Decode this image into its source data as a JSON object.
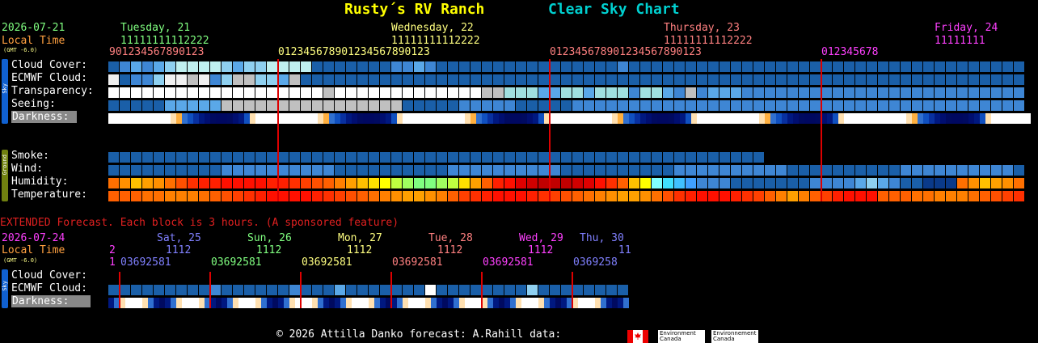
{
  "header": {
    "site_name": "Rusty´s RV Ranch",
    "chart_name": "Clear Sky Chart",
    "site_color": "#ffff00",
    "chart_color": "#00d0d0"
  },
  "main": {
    "date": "2026-07-21",
    "local_time": "Local Time",
    "gmt": "(GMT -6.0)",
    "days": [
      {
        "label": "Tuesday, 21",
        "color": "#80ff80"
      },
      {
        "label": "Wednesday, 22",
        "color": "#ffff80"
      },
      {
        "label": "Thursday, 23",
        "color": "#ff8080"
      },
      {
        "label": "Friday, 24",
        "color": "#ff40ff"
      }
    ],
    "hour_tens": [
      "11111111112222",
      "11111111112222",
      "11111111112222",
      "11111111"
    ],
    "hour_ones": [
      "901234567890123",
      "012345678901234567890123",
      "012345678901234567890123",
      "012345678"
    ],
    "sky_side": "Sky",
    "ground_side": "Ground",
    "rows": {
      "cloud": "Cloud Cover:",
      "ecmwf": "ECMWF Cloud:",
      "transparency": "Transparency:",
      "seeing": "Seeing:",
      "darkness": "Darkness:",
      "smoke": "Smoke:",
      "wind": "Wind:",
      "humidity": "Humidity:",
      "temperature": "Temperature:"
    }
  },
  "extended": {
    "notice": "EXTENDED Forecast. Each block is 3 hours. (A sponsored feature)",
    "date": "2026-07-24",
    "local_time": "Local Time",
    "gmt": "(GMT -6.0)",
    "days": [
      {
        "label": "Sat, 25",
        "color": "#8080ff"
      },
      {
        "label": "Sun, 26",
        "color": "#80ff80"
      },
      {
        "label": "Mon, 27",
        "color": "#ffff80"
      },
      {
        "label": "Tue, 28",
        "color": "#ff8080"
      },
      {
        "label": "Wed, 29",
        "color": "#ff40ff"
      },
      {
        "label": "Thu, 30",
        "color": "#8080ff"
      }
    ],
    "hour_tens": [
      "2",
      "1112",
      "1112",
      "1112",
      "1112",
      "1112",
      "11"
    ],
    "hour_ones": [
      "1",
      "03692581",
      "03692581",
      "03692581",
      "03692581",
      "03692581",
      "0369258"
    ],
    "sky_side": "Sky",
    "rows": {
      "cloud": "Cloud Cover:",
      "ecmwf": "ECMWF Cloud:",
      "darkness": "Darkness:"
    }
  },
  "footer": {
    "copyright": "© 2026 Attilla Danko  forecast: A.Rahill  data:",
    "env1": "Environment Canada",
    "env2": "Environnement Canada"
  },
  "grid_data": {
    "cloud": [
      "#1a5fa8",
      "#3e86d4",
      "#5aa8e8",
      "#3e86d4",
      "#5aa8e8",
      "#8fd0f0",
      "#c0f0f0",
      "#c0f0f0",
      "#c0f0f0",
      "#c0f0f0",
      "#8fd0f0",
      "#5aa8e8",
      "#8fd0f0",
      "#8fd0f0",
      "#c0f0f0",
      "#c0f0f0",
      "#c0f0f0",
      "#c0f0f0",
      "#1a5fa8",
      "#1a5fa8",
      "#1a5fa8",
      "#1a5fa8",
      "#1a5fa8",
      "#1a5fa8",
      "#1a5fa8",
      "#3e86d4",
      "#3e86d4",
      "#5aa8e8",
      "#3e86d4",
      "#1a5fa8",
      "#1a5fa8",
      "#1a5fa8",
      "#1a5fa8",
      "#1a5fa8",
      "#1a5fa8",
      "#1a5fa8",
      "#1a5fa8",
      "#1a5fa8",
      "#1a5fa8",
      "#1a5fa8",
      "#1a5fa8",
      "#1a5fa8",
      "#1a5fa8",
      "#1a5fa8",
      "#1a5fa8",
      "#3e86d4",
      "#1a5fa8",
      "#1a5fa8",
      "#1a5fa8",
      "#1a5fa8",
      "#1a5fa8",
      "#1a5fa8",
      "#1a5fa8",
      "#1a5fa8",
      "#1a5fa8",
      "#1a5fa8",
      "#1a5fa8",
      "#1a5fa8",
      "#1a5fa8",
      "#1a5fa8",
      "#1a5fa8",
      "#1a5fa8",
      "#1a5fa8",
      "#1a5fa8",
      "#1a5fa8",
      "#1a5fa8",
      "#1a5fa8",
      "#1a5fa8",
      "#1a5fa8",
      "#1a5fa8",
      "#1a5fa8",
      "#1a5fa8",
      "#1a5fa8",
      "#1a5fa8",
      "#1a5fa8",
      "#1a5fa8",
      "#1a5fa8",
      "#1a5fa8",
      "#1a5fa8",
      "#1a5fa8",
      "#1a5fa8",
      "#1a5fa8",
      "#1a5fa8",
      "#1a5fa8",
      "#1a5fa8",
      "#1a5fa8",
      "#1a5fa8",
      "#1a5fa8",
      "#1a5fa8",
      "#1a5fa8",
      "#1a5fa8",
      "#1a5fa8",
      "#1a5fa8",
      "#1a5fa8",
      "#1a5fa8",
      "#1a5fa8",
      "#1a5fa8",
      "#1a5fa8",
      "#1a5fa8",
      "#1a5fa8",
      "#1a5fa8",
      "#1a5fa8",
      "#1a5fa8",
      "#1a5fa8",
      "#1a5fa8",
      "#1a5fa8",
      "#1a5fa8",
      "#1a5fa8",
      "#1a5fa8",
      "#1a5fa8",
      "#1a5fa8",
      "#1a5fa8",
      "#1a5fa8",
      "#1a5fa8",
      "#1a5fa8",
      "#1a5fa8",
      "#1a5fa8",
      "#1a5fa8",
      "#1a5fa8",
      "#1a5fa8",
      "#1a5fa8",
      "#1a5fa8",
      "#1a5fa8",
      "#1a5fa8",
      "#1a5fa8",
      "#1a5fa8",
      "#1a5fa8",
      "#1a5fa8",
      "#1a5fa8",
      "#1a5fa8",
      "#1a5fa8",
      "#1a5fa8",
      "#1a5fa8",
      "#1a5fa8",
      "#1a5fa8",
      "#1a5fa8",
      "#1a5fa8",
      "#1a5fa8",
      "#1a5fa8",
      "#1a5fa8",
      "#1a5fa8",
      "#1a5fa8",
      "#1a5fa8",
      "#1a5fa8",
      "#1a5fa8",
      "#1a5fa8",
      "#1a5fa8",
      "#1a5fa8",
      "#1a5fa8"
    ],
    "ecmwf": [
      "#f0f0f0",
      "#1a5fa8",
      "#3e86d4",
      "#3e86d4",
      "#8fd0f0",
      "#f0f0f0",
      "#f0f0f0",
      "#c0c0c0",
      "#f0f0f0",
      "#3e86d4",
      "#8fd0f0",
      "#c0c0c0",
      "#c0c0c0",
      "#8fd0f0",
      "#8fd0f0",
      "#5aa8e8",
      "#c0c0c0",
      "#1a5fa8",
      "#1a5fa8",
      "#1a5fa8",
      "#1a5fa8",
      "#1a5fa8",
      "#1a5fa8",
      "#1a5fa8",
      "#1a5fa8",
      "#1a5fa8",
      "#1a5fa8",
      "#1a5fa8",
      "#1a5fa8",
      "#1a5fa8",
      "#1a5fa8",
      "#1a5fa8",
      "#1a5fa8",
      "#1a5fa8",
      "#1a5fa8",
      "#1a5fa8",
      "#1a5fa8",
      "#1a5fa8",
      "#1a5fa8",
      "#1a5fa8",
      "#1a5fa8",
      "#1a5fa8",
      "#1a5fa8",
      "#1a5fa8",
      "#1a5fa8",
      "#1a5fa8",
      "#1a5fa8",
      "#1a5fa8",
      "#1a5fa8",
      "#1a5fa8",
      "#1a5fa8",
      "#1a5fa8",
      "#1a5fa8",
      "#1a5fa8",
      "#1a5fa8",
      "#1a5fa8",
      "#1a5fa8",
      "#1a5fa8",
      "#1a5fa8",
      "#1a5fa8",
      "#1a5fa8",
      "#1a5fa8",
      "#1a5fa8",
      "#1a5fa8",
      "#1a5fa8",
      "#1a5fa8",
      "#1a5fa8",
      "#1a5fa8",
      "#1a5fa8",
      "#1a5fa8",
      "#1a5fa8",
      "#1a5fa8",
      "#1a5fa8",
      "#1a5fa8",
      "#1a5fa8",
      "#1a5fa8",
      "#1a5fa8",
      "#1a5fa8",
      "#1a5fa8",
      "#1a5fa8",
      "#1a5fa8",
      "#1a5fa8",
      "#1a5fa8",
      "#1a5fa8",
      "#1a5fa8",
      "#1a5fa8",
      "#1a5fa8",
      "#1a5fa8",
      "#1a5fa8",
      "#1a5fa8",
      "#1a5fa8",
      "#1a5fa8",
      "#1a5fa8",
      "#1a5fa8",
      "#1a5fa8",
      "#1a5fa8",
      "#1a5fa8",
      "#1a5fa8",
      "#1a5fa8",
      "#1a5fa8",
      "#1a5fa8",
      "#1a5fa8",
      "#1a5fa8",
      "#1a5fa8",
      "#1a5fa8",
      "#1a5fa8",
      "#1a5fa8",
      "#1a5fa8",
      "#1a5fa8",
      "#1a5fa8",
      "#1a5fa8",
      "#1a5fa8",
      "#1a5fa8",
      "#1a5fa8",
      "#1a5fa8",
      "#1a5fa8",
      "#1a5fa8",
      "#1a5fa8",
      "#1a5fa8",
      "#1a5fa8",
      "#1a5fa8",
      "#1a5fa8",
      "#1a5fa8",
      "#1a5fa8",
      "#1a5fa8",
      "#1a5fa8",
      "#1a5fa8",
      "#1a5fa8",
      "#1a5fa8",
      "#1a5fa8",
      "#1a5fa8",
      "#1a5fa8",
      "#1a5fa8",
      "#1a5fa8",
      "#1a5fa8",
      "#1a5fa8",
      "#1a5fa8",
      "#1a5fa8",
      "#1a5fa8",
      "#1a5fa8",
      "#1a5fa8",
      "#1a5fa8",
      "#1a5fa8",
      "#1a5fa8",
      "#1a5fa8",
      "#1a5fa8",
      "#1a5fa8",
      "#1a5fa8",
      "#1a5fa8",
      "#1a5fa8",
      "#1a5fa8"
    ],
    "transparency": [
      "#ffffff",
      "#ffffff",
      "#ffffff",
      "#ffffff",
      "#ffffff",
      "#ffffff",
      "#ffffff",
      "#ffffff",
      "#ffffff",
      "#ffffff",
      "#ffffff",
      "#ffffff",
      "#ffffff",
      "#ffffff",
      "#ffffff",
      "#ffffff",
      "#ffffff",
      "#ffffff",
      "#ffffff",
      "#c0c0c0",
      "#ffffff",
      "#ffffff",
      "#ffffff",
      "#ffffff",
      "#ffffff",
      "#ffffff",
      "#ffffff",
      "#ffffff",
      "#ffffff",
      "#ffffff",
      "#ffffff",
      "#ffffff",
      "#ffffff",
      "#c0c0c0",
      "#c0c0c0",
      "#a0e0e0",
      "#a0e0e0",
      "#a0e0e0",
      "#5aa8e8",
      "#5aa8e8",
      "#a0e0e0",
      "#a0e0e0",
      "#5aa8e8",
      "#a0e0e0",
      "#a0e0e0",
      "#a0e0e0",
      "#3e86d4",
      "#a0e0e0",
      "#a0e0e0",
      "#5aa8e8",
      "#3e86d4",
      "#c0c0c0",
      "#3e86d4",
      "#5aa8e8",
      "#5aa8e8",
      "#5aa8e8",
      "#3e86d4",
      "#3e86d4",
      "#3e86d4",
      "#3e86d4",
      "#3e86d4",
      "#3e86d4",
      "#3e86d4",
      "#3e86d4",
      "#3e86d4",
      "#3e86d4",
      "#3e86d4",
      "#3e86d4",
      "#3e86d4",
      "#3e86d4",
      "#3e86d4",
      "#3e86d4",
      "#3e86d4",
      "#3e86d4",
      "#3e86d4",
      "#3e86d4",
      "#3e86d4",
      "#3e86d4",
      "#3e86d4",
      "#3e86d4",
      "#3e86d4",
      "#3e86d4",
      "#3e86d4",
      "#3e86d4",
      "#3e86d4",
      "#3e86d4",
      "#3e86d4",
      "#3e86d4",
      "#3e86d4",
      "#3e86d4",
      "#3e86d4",
      "#3e86d4",
      "#3e86d4",
      "#3e86d4",
      "#3e86d4",
      "#3e86d4",
      "#3e86d4",
      "#3e86d4",
      "#3e86d4",
      "#3e86d4",
      "#3e86d4",
      "#3e86d4",
      "#3e86d4",
      "#3e86d4",
      "#3e86d4",
      "#3e86d4",
      "#3e86d4",
      "#3e86d4",
      "#3e86d4",
      "#3e86d4",
      "#3e86d4",
      "#3e86d4",
      "#1a5fa8",
      "#1a5fa8",
      "#1a5fa8",
      "#3e86d4",
      "#3e86d4",
      "#1a5fa8",
      "#1a5fa8",
      "#1a5fa8",
      "#1a5fa8",
      "#1a5fa8",
      "#3e86d4",
      "#3e86d4",
      "#3e86d4",
      "#3e86d4",
      "#3e86d4",
      "#3e86d4",
      "#3e86d4",
      "#3e86d4",
      "#3e86d4",
      "#3e86d4",
      "#3e86d4",
      "#3e86d4",
      "#3e86d4",
      "#1a5fa8",
      "#1a5fa8",
      "#1a5fa8",
      "#1a5fa8",
      "#1a5fa8",
      "#1a5fa8",
      "#1a5fa8",
      "#1a5fa8",
      "#1a5fa8",
      "#1a5fa8",
      "#1a5fa8",
      "#1a5fa8",
      "#1a5fa8",
      "#1a5fa8",
      "#1a5fa8"
    ],
    "seeing": [
      "#1a5fa8",
      "#1a5fa8",
      "#1a5fa8",
      "#1a5fa8",
      "#1a5fa8",
      "#5aa8e8",
      "#5aa8e8",
      "#5aa8e8",
      "#5aa8e8",
      "#5aa8e8",
      "#c0c0c0",
      "#c0c0c0",
      "#c0c0c0",
      "#c0c0c0",
      "#c0c0c0",
      "#c0c0c0",
      "#c0c0c0",
      "#c0c0c0",
      "#c0c0c0",
      "#c0c0c0",
      "#c0c0c0",
      "#c0c0c0",
      "#c0c0c0",
      "#c0c0c0",
      "#c0c0c0",
      "#c0c0c0",
      "#1a5fa8",
      "#1a5fa8",
      "#1a5fa8",
      "#1a5fa8",
      "#1a5fa8",
      "#3e86d4",
      "#3e86d4",
      "#3e86d4",
      "#3e86d4",
      "#3e86d4",
      "#1a5fa8",
      "#1a5fa8",
      "#1a5fa8",
      "#1a5fa8",
      "#1a5fa8",
      "#3e86d4",
      "#3e86d4",
      "#3e86d4",
      "#3e86d4",
      "#3e86d4",
      "#3e86d4",
      "#3e86d4",
      "#3e86d4",
      "#3e86d4",
      "#3e86d4",
      "#3e86d4",
      "#3e86d4",
      "#3e86d4",
      "#3e86d4",
      "#3e86d4",
      "#3e86d4",
      "#3e86d4",
      "#3e86d4",
      "#3e86d4",
      "#3e86d4",
      "#3e86d4",
      "#3e86d4",
      "#3e86d4",
      "#3e86d4",
      "#3e86d4",
      "#3e86d4",
      "#3e86d4",
      "#3e86d4",
      "#3e86d4",
      "#3e86d4",
      "#3e86d4",
      "#3e86d4",
      "#3e86d4",
      "#3e86d4",
      "#3e86d4",
      "#3e86d4",
      "#3e86d4",
      "#3e86d4",
      "#3e86d4",
      "#3e86d4",
      "#3e86d4",
      "#3e86d4",
      "#3e86d4",
      "#3e86d4",
      "#3e86d4",
      "#3e86d4",
      "#3e86d4",
      "#3e86d4",
      "#3e86d4",
      "#3e86d4",
      "#3e86d4",
      "#3e86d4",
      "#3e86d4",
      "#3e86d4",
      "#3e86d4",
      "#3e86d4",
      "#3e86d4",
      "#3e86d4",
      "#3e86d4",
      "#3e86d4",
      "#3e86d4",
      "#3e86d4",
      "#3e86d4",
      "#3e86d4",
      "#3e86d4",
      "#3e86d4",
      "#3e86d4",
      "#3e86d4",
      "#3e86d4",
      "#3e86d4",
      "#3e86d4",
      "#3e86d4",
      "#3e86d4",
      "#3e86d4",
      "#3e86d4",
      "#5aa8e8",
      "#5aa8e8",
      "#5aa8e8",
      "#5aa8e8",
      "#5aa8e8",
      "#5aa8e8",
      "#5aa8e8",
      "#5aa8e8",
      "#5aa8e8",
      "#5aa8e8",
      "#5aa8e8",
      "#5aa8e8",
      "#5aa8e8",
      "#5aa8e8",
      "#5aa8e8",
      "#5aa8e8",
      "#5aa8e8",
      "#5aa8e8",
      "#5aa8e8",
      "#5aa8e8",
      "#3e86d4",
      "#3e86d4",
      "#3e86d4",
      "#3e86d4",
      "#3e86d4",
      "#1a5fa8",
      "#1a5fa8",
      "#1a5fa8",
      "#1a5fa8",
      "#1a5fa8",
      "#3e86d4",
      "#3e86d4",
      "#3e86d4",
      "#3e86d4",
      "#3e86d4"
    ],
    "darkness_pattern": [
      "#ffffff",
      "#ffffff",
      "#ffffff",
      "#ffffff",
      "#ffffff",
      "#ffffff",
      "#ffffff",
      "#ffffff",
      "#ffffff",
      "#ffffff",
      "#ffffff",
      "#ffe0b0",
      "#ffb040",
      "#3070d0",
      "#1050c0",
      "#0830a0",
      "#001880",
      "#000e70",
      "#000a60",
      "#000860",
      "#000860",
      "#000a60",
      "#000e70",
      "#001880",
      "#1050c0",
      "#ffe0b0"
    ],
    "smoke_count": 115,
    "wind": [
      "#1a5fa8",
      "#1a5fa8",
      "#1a5fa8",
      "#1a5fa8",
      "#1a5fa8",
      "#1a5fa8",
      "#1a5fa8",
      "#1a5fa8",
      "#1a5fa8",
      "#1a5fa8",
      "#3e86d4",
      "#3e86d4",
      "#3e86d4",
      "#3e86d4",
      "#3e86d4",
      "#3e86d4",
      "#3e86d4",
      "#3e86d4",
      "#3e86d4",
      "#3e86d4"
    ],
    "humidity": [
      "#ff7000",
      "#ff9000",
      "#ffc000",
      "#ffa000",
      "#ff9000",
      "#ff7000",
      "#ff5000",
      "#ff3000",
      "#ff2000",
      "#ff2000",
      "#ff1000",
      "#ff1000",
      "#ff1000",
      "#ff1000",
      "#ff2000",
      "#ff2000",
      "#ff3000",
      "#ff4000",
      "#ff5000",
      "#ff6000",
      "#ff8000",
      "#ffa000",
      "#ffc000",
      "#ffe000",
      "#ffff00",
      "#c0ff40",
      "#a0ff60",
      "#80ff80",
      "#80ff80",
      "#a0ff60",
      "#c0ff40",
      "#ffe000",
      "#ffa000",
      "#ff6000",
      "#ff2000",
      "#ff1000",
      "#e00000",
      "#d00000",
      "#c00000",
      "#c00000",
      "#c00000",
      "#d00000",
      "#e00000",
      "#ff1000",
      "#ff3000",
      "#ff6000",
      "#ffc000",
      "#ffff00",
      "#80ffff",
      "#40e0ff",
      "#40c0ff",
      "#40a0ff",
      "#3e86d4",
      "#3e86d4",
      "#3e86d4",
      "#1a5fa8",
      "#1a5fa8",
      "#1a5fa8",
      "#1a5fa8",
      "#1a5fa8",
      "#1a5fa8",
      "#1a5fa8",
      "#3e86d4",
      "#3e86d4",
      "#3e86d4",
      "#3e86d4",
      "#5aa8e8",
      "#8fd0f0",
      "#5aa8e8",
      "#3e86d4",
      "#1a5fa8",
      "#1a5fa8",
      "#0a3a8a",
      "#0a3a8a",
      "#0a3a8a"
    ],
    "temperature": [
      "#ff6000",
      "#ff6000",
      "#ff6000",
      "#ff7000",
      "#ff7000",
      "#ff8000",
      "#ff8000",
      "#ff8000",
      "#ff7000",
      "#ff6000",
      "#ff5000",
      "#ff4000",
      "#ff3000",
      "#ff2000",
      "#ff1000",
      "#ff1000",
      "#ff1000",
      "#ff1000",
      "#ff2000",
      "#ff3000",
      "#ff4000",
      "#ff5000",
      "#ff6000",
      "#ff7000",
      "#ff8000",
      "#ff9000",
      "#ffa000",
      "#ffa000",
      "#ff9000",
      "#ff8000",
      "#ff6000",
      "#ff4000",
      "#ff3000",
      "#ff2000",
      "#ff1000",
      "#ff1000",
      "#ff1000",
      "#ff2000",
      "#ff3000",
      "#ff4000",
      "#ff5000",
      "#ff6000",
      "#ff7000",
      "#ff8000",
      "#ff9000",
      "#ffa000",
      "#ffa000",
      "#ff9000",
      "#ff7000",
      "#ff5000",
      "#ff3000",
      "#ff2000",
      "#ff1000",
      "#ff1000",
      "#ff1000",
      "#ff2000",
      "#ff3000",
      "#ff4000",
      "#ff6000",
      "#ff8000",
      "#ffa000",
      "#ff8000",
      "#ff6000",
      "#ff4000",
      "#ff2000",
      "#ff1000",
      "#ff1000",
      "#ff1000"
    ],
    "ext_cloud": [
      "#1a5fa8",
      "#1a5fa8",
      "#1a5fa8",
      "#1a5fa8",
      "#1a5fa8",
      "#1a5fa8",
      "#1a5fa8",
      "#1a5fa8",
      "#1a5fa8",
      "#1a5fa8",
      "#1a5fa8",
      "#1a5fa8",
      "#1a5fa8",
      "#1a5fa8",
      "#1a5fa8",
      "#1a5fa8",
      "#1a5fa8",
      "#1a5fa8",
      "#1a5fa8",
      "#1a5fa8",
      "#1a5fa8",
      "#1a5fa8",
      "#1a5fa8",
      "#1a5fa8",
      "#1a5fa8",
      "#1a5fa8",
      "#1a5fa8",
      "#1a5fa8",
      "#1a5fa8",
      "#1a5fa8",
      "#1a5fa8",
      "#1a5fa8",
      "#1a5fa8",
      "#1a5fa8",
      "#1a5fa8",
      "#1a5fa8",
      "#1a5fa8",
      "#1a5fa8",
      "#1a5fa8",
      "#1a5fa8",
      "#1a5fa8",
      "#1a5fa8",
      "#1a5fa8",
      "#1a5fa8",
      "#1a5fa8",
      "#1a5fa8",
      "#1a5fa8",
      "#1a5fa8",
      "#1a5fa8",
      "#1a5fa8",
      "#1a5fa8",
      "#1a5fa8",
      "#1a5fa8",
      "#1a5fa8",
      "#1a5fa8",
      "#1a5fa8",
      "#1a5fa8"
    ],
    "ext_ecmwf": [
      "#1a5fa8",
      "#1a5fa8",
      "#1a5fa8",
      "#1a5fa8",
      "#1a5fa8",
      "#1a5fa8",
      "#1a5fa8",
      "#1a5fa8",
      "#1a5fa8",
      "#3e86d4",
      "#1a5fa8",
      "#1a5fa8",
      "#1a5fa8",
      "#1a5fa8",
      "#1a5fa8",
      "#1a5fa8",
      "#3e86d4",
      "#1a5fa8",
      "#1a5fa8",
      "#1a5fa8",
      "#5aa8e8",
      "#1a5fa8",
      "#1a5fa8",
      "#1a5fa8",
      "#1a5fa8",
      "#1a5fa8",
      "#1a5fa8",
      "#1a5fa8",
      "#ffffff",
      "#1a5fa8",
      "#1a5fa8",
      "#1a5fa8",
      "#1a5fa8",
      "#1a5fa8",
      "#1a5fa8",
      "#1a5fa8",
      "#1a5fa8",
      "#8fd0f0",
      "#1a5fa8",
      "#1a5fa8",
      "#1a5fa8",
      "#1a5fa8",
      "#1a5fa8",
      "#1a5fa8",
      "#1a5fa8",
      "#1a5fa8",
      "#1a5fa8",
      "#1a5fa8",
      "#1a5fa8",
      "#5aa8e8",
      "#1a5fa8",
      "#1a5fa8",
      "#1a5fa8",
      "#1a5fa8",
      "#1a5fa8",
      "#1a5fa8",
      "#1a5fa8"
    ],
    "ext_darkness": [
      "#001880",
      "#3070d0",
      "#ffe0b0",
      "#ffffff",
      "#ffffff",
      "#ffffff",
      "#ffe0b0",
      "#3070d0",
      "#001880",
      "#000a60"
    ]
  }
}
